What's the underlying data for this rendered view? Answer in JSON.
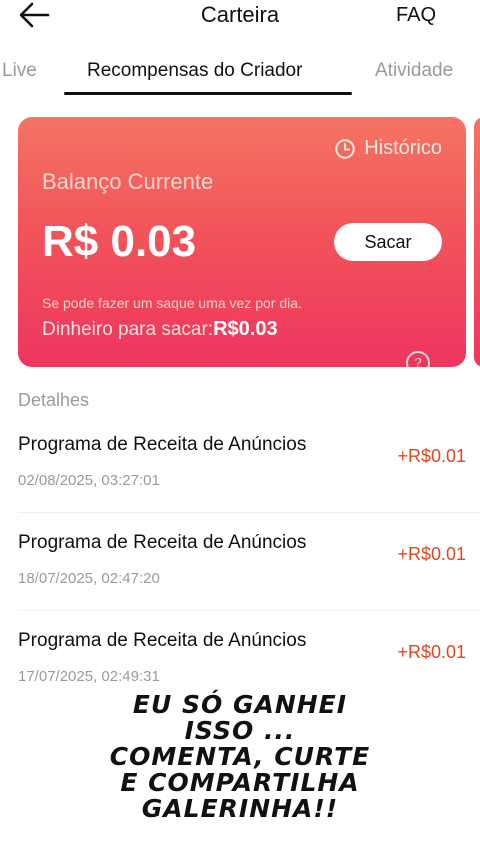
{
  "header": {
    "title": "Carteira",
    "faq": "FAQ",
    "back_icon": "arrow-left-icon"
  },
  "tabs": [
    {
      "label": "Live",
      "active": false
    },
    {
      "label": "Recompensas do Criador",
      "active": true
    },
    {
      "label": "Atividade",
      "active": false
    }
  ],
  "card": {
    "history_label": "Histórico",
    "balance_label": "Balanço Currente",
    "balance_amount": "R$ 0.03",
    "withdraw_button": "Sacar",
    "note": "Se pode fazer um saque uma vez por dia.",
    "available_label": "Dinheiro para sacar:",
    "available_value": "R$0.03",
    "help_icon": "?"
  },
  "details": {
    "label": "Detalhes",
    "items": [
      {
        "name": "Programa de Receita de Anúncios",
        "date": "02/08/2025, 03:27:01",
        "amount": "+R$0.01"
      },
      {
        "name": "Programa de Receita de Anúncios",
        "date": "18/07/2025, 02:47:20",
        "amount": "+R$0.01"
      },
      {
        "name": "Programa de Receita de Anúncios",
        "date": "17/07/2025, 02:49:31",
        "amount": "+R$0.01"
      }
    ]
  },
  "caption": {
    "line1": "EU SÓ GANHEI",
    "line2": "ISSO ...",
    "line3": "COMENTA, CURTE",
    "line4": "E COMPARTILHA",
    "line5": "GALERINHA!!"
  },
  "colors": {
    "accent_amount": "#e2461e",
    "card_top": "#f47463",
    "card_bottom": "#ee3560"
  }
}
